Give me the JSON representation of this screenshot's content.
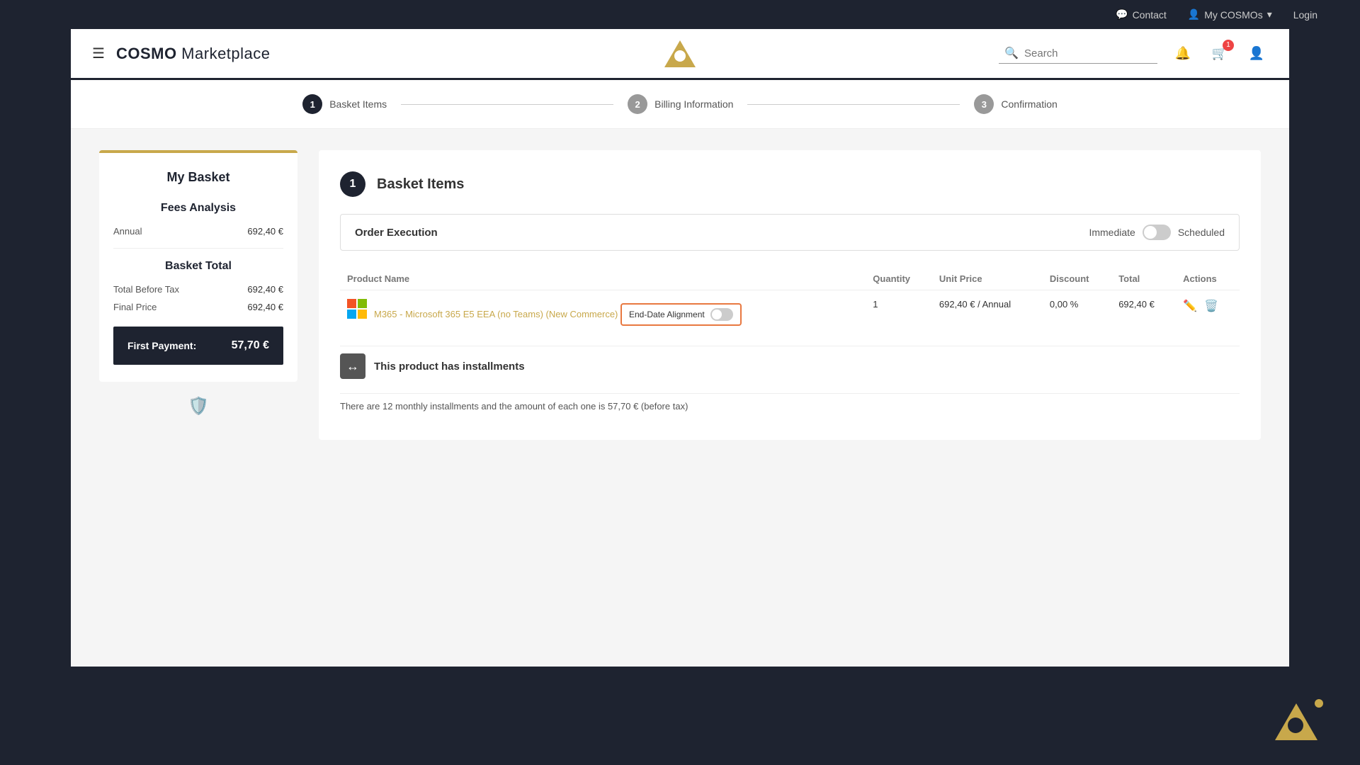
{
  "topbar": {
    "contact_label": "Contact",
    "my_cosmos_label": "My COSMOs",
    "login_label": "Login"
  },
  "header": {
    "logo_text_cosmo": "COSMO",
    "logo_text_marketplace": " Marketplace",
    "search_placeholder": "Search"
  },
  "steps": [
    {
      "number": "1",
      "label": "Basket Items",
      "state": "active"
    },
    {
      "number": "2",
      "label": "Billing Information",
      "state": "inactive"
    },
    {
      "number": "3",
      "label": "Confirmation",
      "state": "inactive"
    }
  ],
  "sidebar": {
    "title": "My Basket",
    "fees_analysis_title": "Fees Analysis",
    "annual_label": "Annual",
    "annual_value": "692,40 €",
    "basket_total_title": "Basket Total",
    "total_before_tax_label": "Total Before Tax",
    "total_before_tax_value": "692,40 €",
    "final_price_label": "Final Price",
    "final_price_value": "692,40 €",
    "first_payment_label": "First Payment:",
    "first_payment_value": "57,70 €"
  },
  "main": {
    "section_number": "1",
    "section_title": "Basket Items",
    "order_execution_label": "Order Execution",
    "immediate_label": "Immediate",
    "scheduled_label": "Scheduled",
    "table": {
      "columns": [
        "Product Name",
        "Quantity",
        "Unit Price",
        "Discount",
        "Total",
        "Actions"
      ],
      "row": {
        "product_name": "M365 - Microsoft 365 E5 EEA (no Teams) (New Commerce)",
        "quantity": "1",
        "unit_price": "692,40 € / Annual",
        "discount": "0,00 %",
        "total": "692,40 €"
      }
    },
    "end_date_alignment_label": "End-Date Alignment",
    "installments_label": "This product has installments",
    "installments_desc": "There are 12 monthly installments and the amount of each one is 57,70 € (before tax)"
  },
  "cart_badge": "1"
}
